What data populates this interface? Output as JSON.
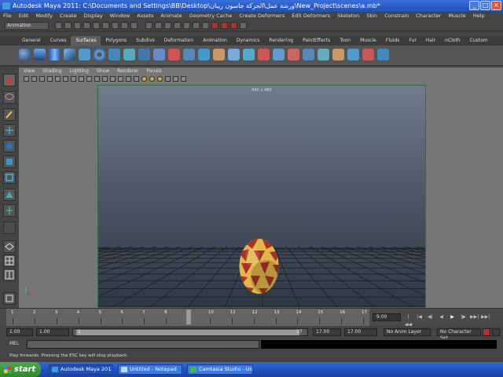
{
  "window": {
    "title": "Autodesk Maya 2011: C:\\Documents and Settings\\BB\\Desktop\\ورشة عمل\\الحركة جاسون ريبان\\New_Project\\scenes\\a.mb*",
    "minimize": "_",
    "maximize": "□",
    "close": "×"
  },
  "menubar": [
    "File",
    "Edit",
    "Modify",
    "Create",
    "Display",
    "Window",
    "Assets",
    "Animate",
    "Geometry Cache",
    "Create Deformers",
    "Edit Deformers",
    "Skeleton",
    "Skin",
    "Constrain",
    "Character",
    "Muscle",
    "Help"
  ],
  "statusline": {
    "mode": "Animation"
  },
  "shelf": {
    "tabs": [
      "General",
      "Curves",
      "Surfaces",
      "Polygons",
      "Subdivs",
      "Deformation",
      "Animation",
      "Dynamics",
      "Rendering",
      "PaintEffects",
      "Toon",
      "Muscle",
      "Fluids",
      "Fur",
      "Hair",
      "nCloth",
      "Custom"
    ],
    "active_tab": "Surfaces"
  },
  "panel": {
    "menu": [
      "View",
      "Shading",
      "Lighting",
      "Show",
      "Renderer",
      "Panels"
    ],
    "resolution_gate": "640 x 480"
  },
  "timeslider": {
    "ticks": [
      "1",
      "2",
      "3",
      "4",
      "5",
      "6",
      "7",
      "8",
      "9",
      "10",
      "11",
      "12",
      "13",
      "14",
      "15",
      "16",
      "17"
    ],
    "current_frame": "9.00",
    "current_marker": "9",
    "playback": [
      "|◀◀",
      "|◀",
      "◀|",
      "◀",
      "▶",
      "|▶",
      "▶▶|",
      "▶▶|"
    ]
  },
  "range": {
    "start_time": "1.00",
    "playback_start": "1.00",
    "range_start": "1",
    "range_end": "17",
    "playback_end": "17.00",
    "end_time": "17.00",
    "anim_layer": "No Anim Layer",
    "character_set": "No Character Set"
  },
  "commandline": {
    "label": "MEL"
  },
  "helpline": {
    "text": "Play forwards. Pressing the ESC key will stop playback."
  },
  "taskbar": {
    "start": "start",
    "buttons": [
      "Autodesk Maya 2011...",
      "Untitled - Notepad",
      "Camtasia Studio - Unt..."
    ]
  },
  "colors": {
    "egg_red": "#a8322a",
    "egg_yellow": "#e2b64a",
    "viewport_border": "#2d6e42"
  }
}
